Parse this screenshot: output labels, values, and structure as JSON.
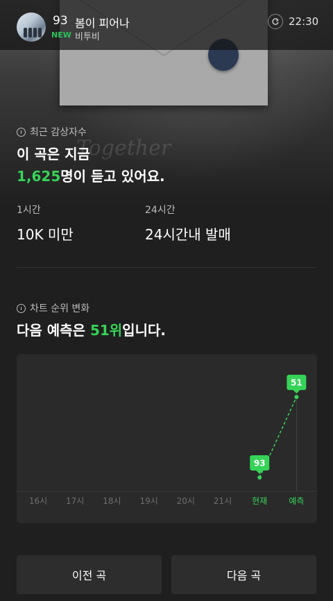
{
  "header": {
    "rank": "93",
    "song_title": "봄이 피어나",
    "new_badge": "NEW",
    "artist": "비투비",
    "time": "22:30"
  },
  "hero": {
    "watermark_text": "Together"
  },
  "listeners": {
    "section_label": "최근 감상자수",
    "headline_1": "이 곡은 지금",
    "count": "1,625",
    "headline_2_suffix": "명이 듣고 있어요.",
    "stats": [
      {
        "label": "1시간",
        "value": "10K 미만"
      },
      {
        "label": "24시간",
        "value": "24시간내 발매"
      }
    ]
  },
  "rank_change": {
    "section_label": "차트 순위 변화",
    "headline_prefix": "다음 예측은 ",
    "predicted_rank": "51위",
    "headline_suffix": "입니다."
  },
  "chart_data": {
    "type": "line",
    "categories": [
      "16시",
      "17시",
      "18시",
      "19시",
      "20시",
      "21시",
      "현재",
      "예측"
    ],
    "series": [
      {
        "values": [
          null,
          null,
          null,
          null,
          null,
          null,
          93,
          51
        ]
      }
    ],
    "point_labels": [
      "93",
      "51"
    ],
    "y_inverted": true,
    "highlight_categories": [
      "현재",
      "예측"
    ],
    "colors": {
      "accent": "#36d358",
      "axis_text": "#6f6f6f"
    }
  },
  "buttons": {
    "prev": "이전 곡",
    "next": "다음 곡"
  }
}
